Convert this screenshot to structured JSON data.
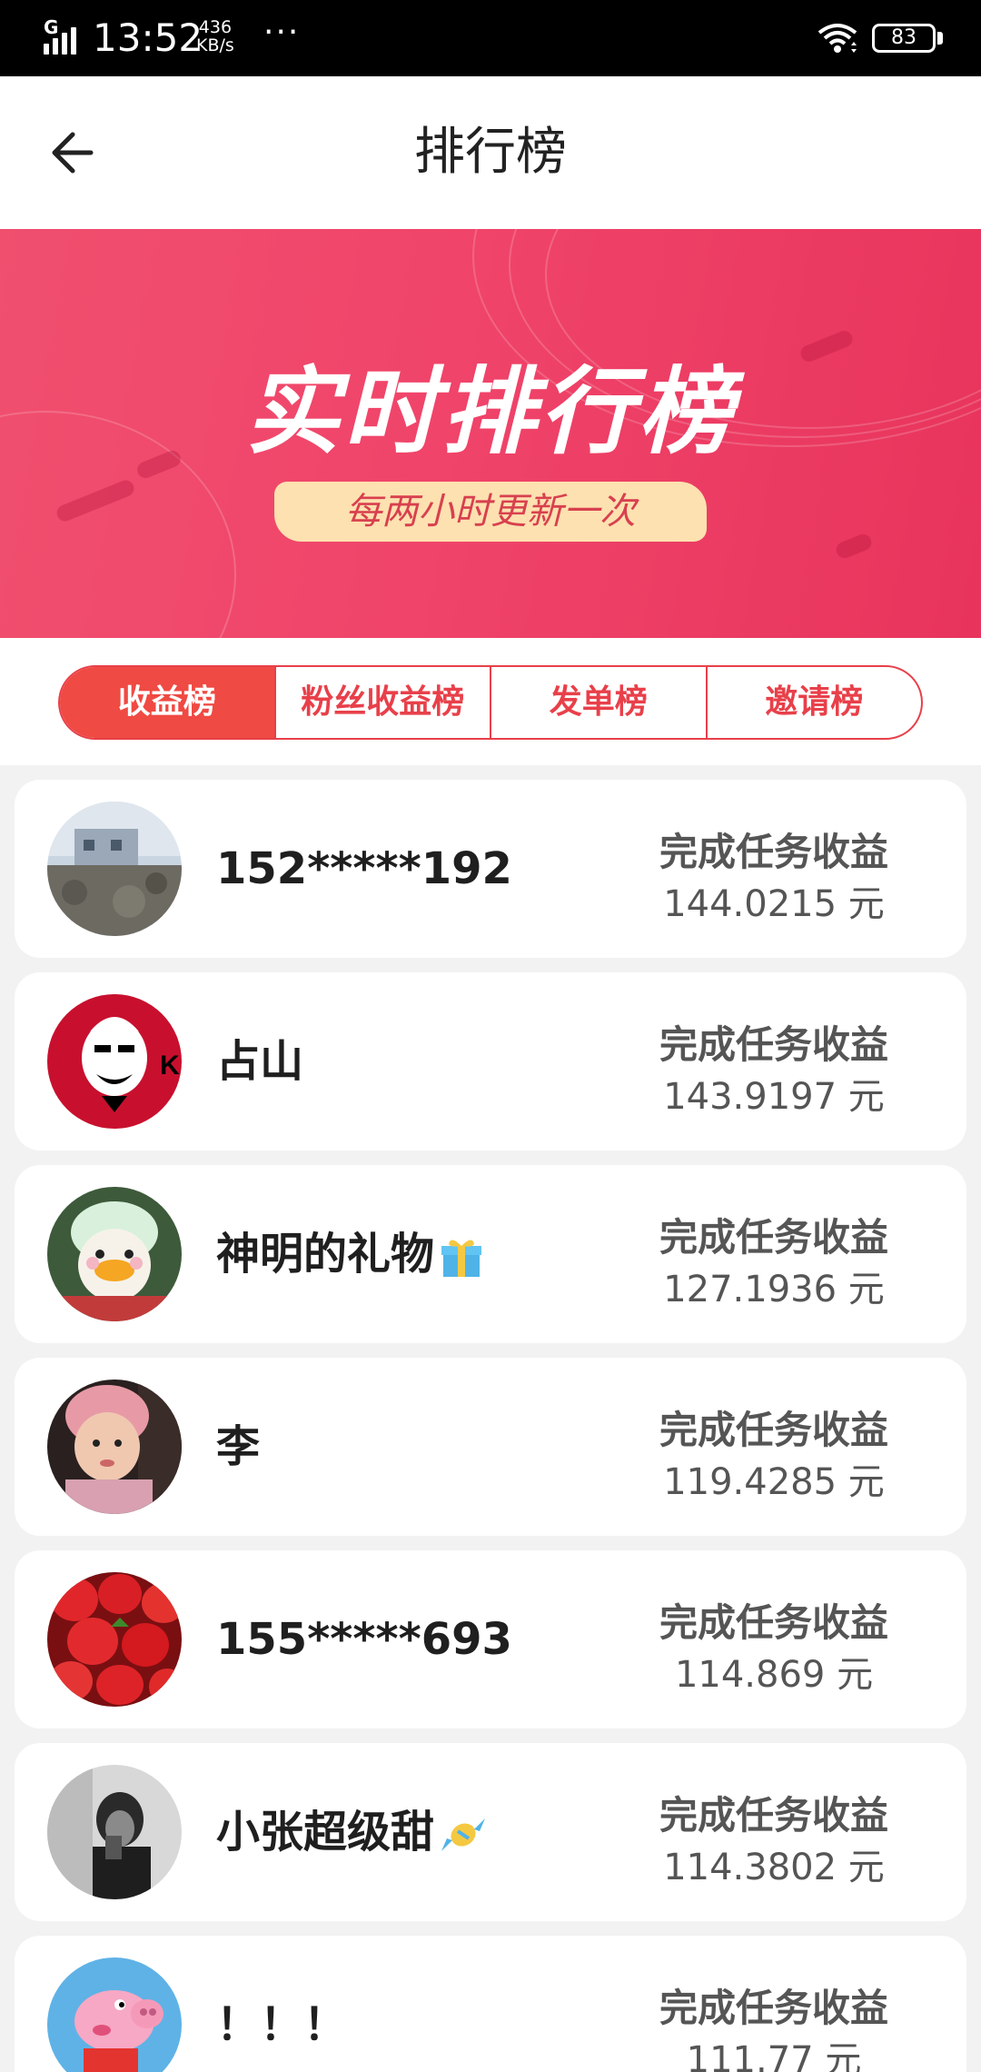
{
  "status_bar": {
    "network_type": "G",
    "time": "13:52",
    "net_speed_value": "436",
    "net_speed_unit": "KB/s",
    "more": "···",
    "battery": "83"
  },
  "header": {
    "title": "排行榜",
    "back_icon": "arrow-left-icon"
  },
  "banner": {
    "title": "实时排行榜",
    "subtitle": "每两小时更新一次"
  },
  "tabs": [
    {
      "label": "收益榜",
      "active": true
    },
    {
      "label": "粉丝收益榜",
      "active": false
    },
    {
      "label": "发单榜",
      "active": false
    },
    {
      "label": "邀请榜",
      "active": false
    }
  ],
  "rankings": [
    {
      "name": "152*****192",
      "earn_label": "完成任务收益",
      "amount": "144.0215 元"
    },
    {
      "name": "占山",
      "earn_label": "完成任务收益",
      "amount": "143.9197 元"
    },
    {
      "name": "神明的礼物",
      "earn_label": "完成任务收益",
      "amount": "127.1936 元"
    },
    {
      "name": "李",
      "earn_label": "完成任务收益",
      "amount": "119.4285 元"
    },
    {
      "name": "155*****693",
      "earn_label": "完成任务收益",
      "amount": "114.869 元"
    },
    {
      "name": "小张超级甜",
      "earn_label": "完成任务收益",
      "amount": "114.3802 元"
    },
    {
      "name": "！！！",
      "earn_label": "完成任务收益",
      "amount": "111.77 元"
    }
  ],
  "colors": {
    "accent": "#ef4a43",
    "banner": "#f0446a",
    "subtitle_bg": "#fde1b0"
  }
}
